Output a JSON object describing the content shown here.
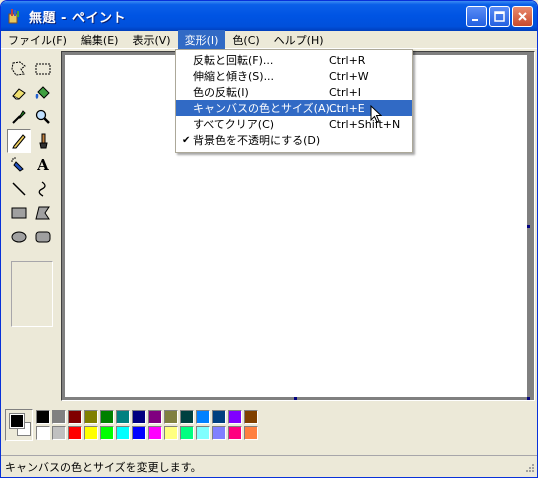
{
  "window": {
    "title": "無題 - ペイント",
    "minimize": "_",
    "maximize": "□",
    "close": "✕"
  },
  "menubar": {
    "items": [
      {
        "label": "ファイル(F)"
      },
      {
        "label": "編集(E)"
      },
      {
        "label": "表示(V)"
      },
      {
        "label": "変形(I)"
      },
      {
        "label": "色(C)"
      },
      {
        "label": "ヘルプ(H)"
      }
    ]
  },
  "dropdown": {
    "items": [
      {
        "label": "反転と回転(F)...",
        "shortcut": "Ctrl+R"
      },
      {
        "label": "伸縮と傾き(S)...",
        "shortcut": "Ctrl+W"
      },
      {
        "label": "色の反転(I)",
        "shortcut": "Ctrl+I"
      },
      {
        "label": "キャンバスの色とサイズ(A)...",
        "shortcut": "Ctrl+E"
      },
      {
        "label": "すべてクリア(C)",
        "shortcut": "Ctrl+Shift+N"
      },
      {
        "label": "背景色を不透明にする(D)",
        "shortcut": "",
        "check": "✔"
      }
    ]
  },
  "toolbox": {
    "tools": [
      "free-select-icon",
      "rect-select-icon",
      "eraser-icon",
      "fill-icon",
      "color-picker-icon",
      "magnifier-icon",
      "pencil-icon",
      "brush-icon",
      "airbrush-icon",
      "text-icon",
      "line-icon",
      "curve-icon",
      "rectangle-icon",
      "polygon-icon",
      "ellipse-icon",
      "rounded-rect-icon"
    ],
    "text_tool_glyph": "A"
  },
  "palette": {
    "foreground": "#000000",
    "background": "#FFFFFF",
    "top_row": [
      "#000000",
      "#808080",
      "#800000",
      "#808000",
      "#008000",
      "#008080",
      "#000080",
      "#800080",
      "#808040",
      "#004040",
      "#0080FF",
      "#004080",
      "#8000FF",
      "#804000"
    ],
    "bottom_row": [
      "#FFFFFF",
      "#C0C0C0",
      "#FF0000",
      "#FFFF00",
      "#00FF00",
      "#00FFFF",
      "#0000FF",
      "#FF00FF",
      "#FFFF80",
      "#00FF80",
      "#80FFFF",
      "#8080FF",
      "#FF0080",
      "#FF8040"
    ]
  },
  "statusbar": {
    "text": "キャンバスの色とサイズを変更します。"
  },
  "colors": {
    "titlebar": "#0054E3",
    "menu_highlight": "#316AC5",
    "workspace": "#808080"
  }
}
